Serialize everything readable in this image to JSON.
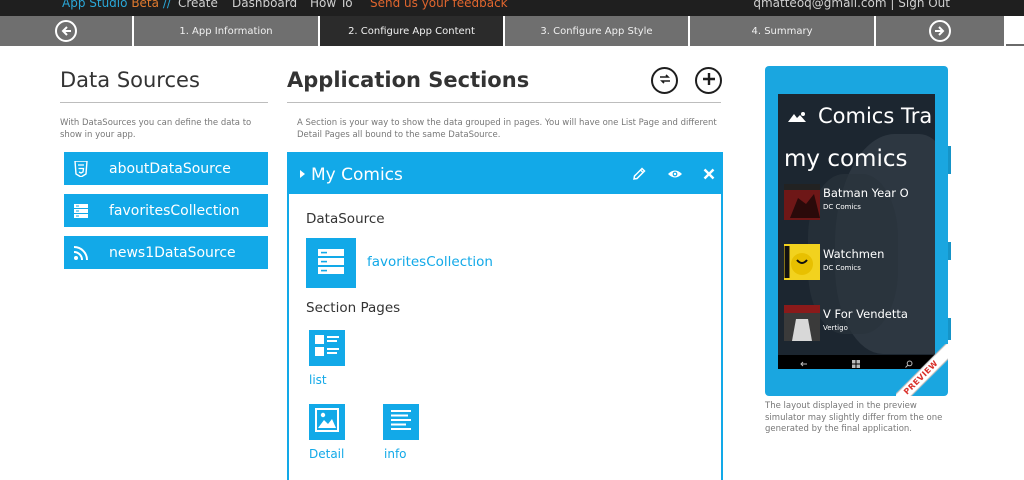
{
  "topnav": {
    "brand": "App Studio",
    "beta": "Beta",
    "brand_slash": "//",
    "items": [
      "Create",
      "Dashboard",
      "How To"
    ],
    "feedback": "Send us your feedback",
    "user": "qmatteoq@gmail.com",
    "separator": "|",
    "signout": "Sign Out"
  },
  "steps": [
    {
      "label": "1. App Information"
    },
    {
      "label": "2. Configure App Content"
    },
    {
      "label": "3. Configure App Style"
    },
    {
      "label": "4. Summary"
    }
  ],
  "data_sources": {
    "title": "Data Sources",
    "description": "With DataSources you can define the data to show in your app.",
    "items": [
      {
        "label": "aboutDataSource",
        "icon": "html5-icon"
      },
      {
        "label": "favoritesCollection",
        "icon": "database-icon"
      },
      {
        "label": "news1DataSource",
        "icon": "rss-icon"
      }
    ]
  },
  "app_sections": {
    "title": "Application Sections",
    "description": "A Section is your way to show the data grouped in pages. You will have one List Page and different Detail Pages all bound to the same DataSource.",
    "section": {
      "name": "My Comics",
      "datasource_label": "DataSource",
      "datasource_name": "favoritesCollection",
      "pages_label": "Section Pages",
      "pages": [
        {
          "label": "list"
        },
        {
          "label": "Detail"
        },
        {
          "label": "info"
        }
      ]
    }
  },
  "preview": {
    "app_title": "Comics Tra",
    "section_title": "my comics",
    "items": [
      {
        "title": "Batman Year O",
        "publisher": "DC Comics"
      },
      {
        "title": "Watchmen",
        "publisher": "DC Comics"
      },
      {
        "title": "V For Vendetta",
        "publisher": "Vertigo"
      }
    ],
    "ribbon": "PREVIEW",
    "note": "The layout displayed in the preview simulator may slightly differ from the one generated by the final application."
  },
  "colors": {
    "accent": "#12a9e8",
    "nav_bg": "#1f1f1f",
    "step_bg": "#6f6f6f",
    "step_active": "#2b2b2b",
    "phone": "#1aa6e0"
  }
}
